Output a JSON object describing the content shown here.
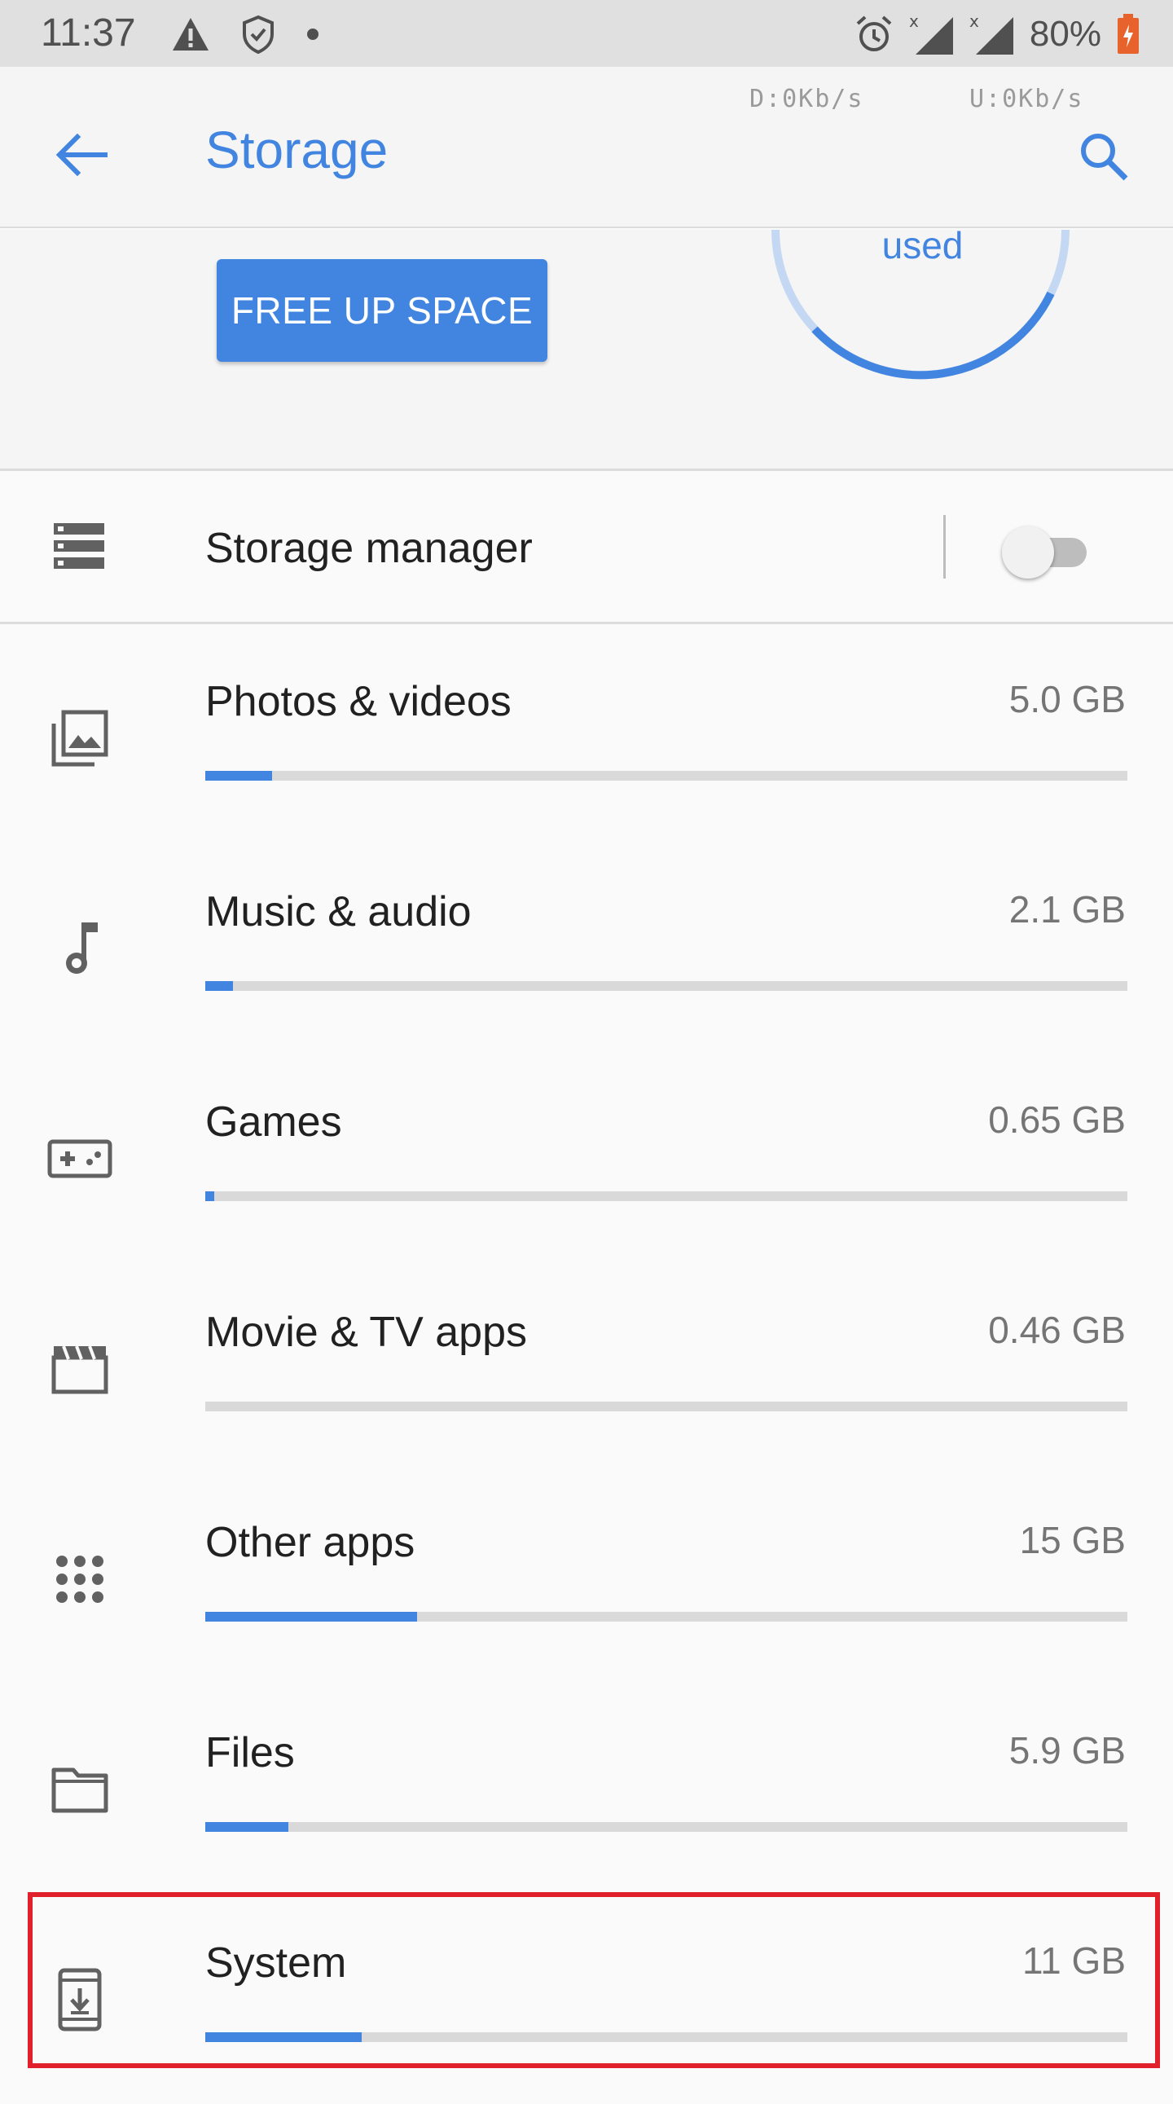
{
  "status_bar": {
    "time": "11:37",
    "battery_percent": "80%",
    "icons": [
      "warning-icon",
      "shield-icon",
      "dot-icon",
      "alarm-icon",
      "signal-icon",
      "signal-icon",
      "battery-icon"
    ]
  },
  "app_bar": {
    "title": "Storage",
    "download_speed": "D:0Kb/s",
    "upload_speed": "U:0Kb/s"
  },
  "summary": {
    "used_label": "used",
    "free_up_button": "FREE UP SPACE"
  },
  "storage_manager": {
    "label": "Storage manager",
    "enabled": false
  },
  "categories": [
    {
      "label": "Photos & videos",
      "size": "5.0 GB",
      "fill_fraction": 0.072,
      "icon": "photo-library-icon"
    },
    {
      "label": "Music & audio",
      "size": "2.1 GB",
      "fill_fraction": 0.03,
      "icon": "music-note-icon"
    },
    {
      "label": "Games",
      "size": "0.65 GB",
      "fill_fraction": 0.01,
      "icon": "gamepad-icon"
    },
    {
      "label": "Movie & TV apps",
      "size": "0.46 GB",
      "fill_fraction": 0.0,
      "icon": "movie-icon"
    },
    {
      "label": "Other apps",
      "size": "15 GB",
      "fill_fraction": 0.23,
      "icon": "apps-icon"
    },
    {
      "label": "Files",
      "size": "5.9 GB",
      "fill_fraction": 0.09,
      "icon": "folder-icon"
    },
    {
      "label": "System",
      "size": "11 GB",
      "fill_fraction": 0.17,
      "icon": "system-update-icon"
    }
  ],
  "colors": {
    "accent": "#4285e0",
    "highlight": "#e0202a",
    "bar_track": "#d9d9d9"
  }
}
